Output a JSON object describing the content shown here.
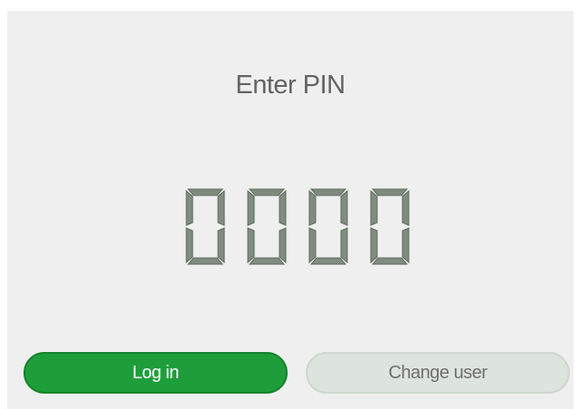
{
  "prompt": {
    "title": "Enter PIN"
  },
  "pin": {
    "digits": [
      "0",
      "0",
      "0",
      "0"
    ]
  },
  "actions": {
    "login_label": "Log in",
    "change_user_label": "Change user"
  },
  "colors": {
    "panel_bg": "#efefef",
    "segment_fill": "#7f8c7f",
    "segment_stroke": "#5f6b5f",
    "login_bg": "#1e9e3a",
    "change_user_bg": "#dde3dd"
  }
}
